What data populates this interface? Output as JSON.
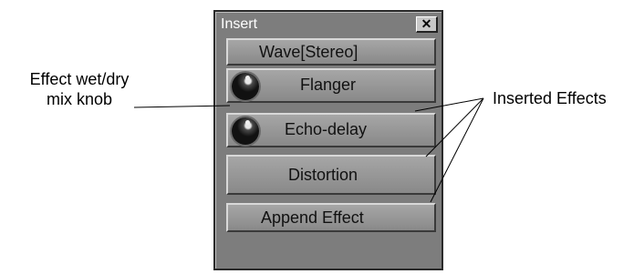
{
  "window": {
    "title": "Insert",
    "close_glyph": "✕"
  },
  "slots": [
    {
      "label": "Wave[Stereo]",
      "has_knob": false
    },
    {
      "label": "Flanger",
      "has_knob": true
    },
    {
      "label": "Echo-delay",
      "has_knob": true
    },
    {
      "label": "Distortion",
      "has_knob": false
    },
    {
      "label": "Append Effect",
      "has_knob": false
    }
  ],
  "annotations": {
    "knob_label_line1": "Effect wet/dry",
    "knob_label_line2": "mix knob",
    "effects_label": "Inserted Effects"
  }
}
